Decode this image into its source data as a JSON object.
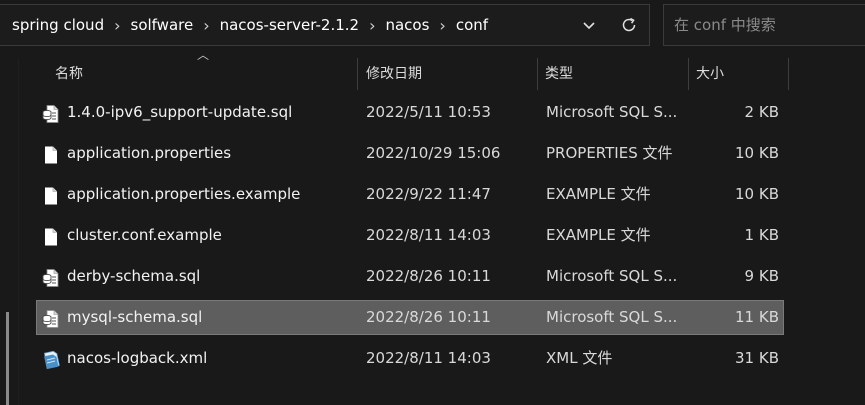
{
  "breadcrumb": [
    "spring cloud",
    "solfware",
    "nacos-server-2.1.2",
    "nacos",
    "conf"
  ],
  "search": {
    "placeholder": "在 conf 中搜索"
  },
  "columns": {
    "name": "名称",
    "date": "修改日期",
    "type": "类型",
    "size": "大小"
  },
  "files": [
    {
      "icon": "sql-file-icon",
      "name": "1.4.0-ipv6_support-update.sql",
      "date": "2022/5/11 10:53",
      "type": "Microsoft SQL S...",
      "size": "2 KB"
    },
    {
      "icon": "file-icon",
      "name": "application.properties",
      "date": "2022/10/29 15:06",
      "type": "PROPERTIES 文件",
      "size": "10 KB"
    },
    {
      "icon": "file-icon",
      "name": "application.properties.example",
      "date": "2022/9/22 11:47",
      "type": "EXAMPLE 文件",
      "size": "10 KB"
    },
    {
      "icon": "file-icon",
      "name": "cluster.conf.example",
      "date": "2022/8/11 14:03",
      "type": "EXAMPLE 文件",
      "size": "1 KB"
    },
    {
      "icon": "sql-file-icon",
      "name": "derby-schema.sql",
      "date": "2022/8/26 10:11",
      "type": "Microsoft SQL S...",
      "size": "9 KB"
    },
    {
      "icon": "sql-file-icon",
      "name": "mysql-schema.sql",
      "date": "2022/8/26 10:11",
      "type": "Microsoft SQL S...",
      "size": "11 KB",
      "selected": true
    },
    {
      "icon": "xml-file-icon",
      "name": "nacos-logback.xml",
      "date": "2022/8/11 14:03",
      "type": "XML 文件",
      "size": "31 KB"
    }
  ]
}
